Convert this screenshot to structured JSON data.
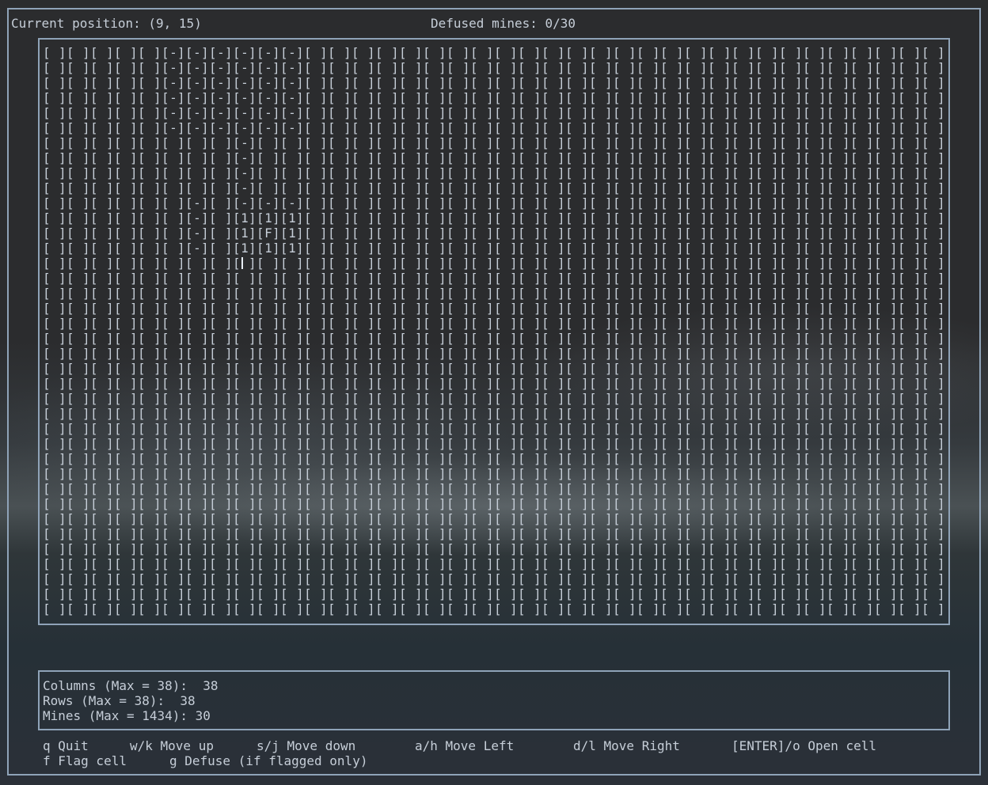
{
  "status": {
    "position_label": "Current position: (9, 15)",
    "defused_label": "Defused mines: 0/30"
  },
  "board": {
    "columns": 38,
    "rows": 38,
    "cursor": {
      "col": 8,
      "row": 14
    },
    "cell_symbols": {
      "closed": " ",
      "empty": "-",
      "flag": "F",
      "one": "1"
    },
    "revealed_rows": [
      [
        "",
        "",
        "",
        "",
        "",
        "-",
        "-",
        "-",
        "-",
        "-",
        "-"
      ],
      [
        "",
        "",
        "",
        "",
        "",
        "-",
        "-",
        "-",
        "-",
        "-",
        "-"
      ],
      [
        "",
        "",
        "",
        "",
        "",
        "-",
        "-",
        "-",
        "-",
        "-",
        "-"
      ],
      [
        "",
        "",
        "",
        "",
        "",
        "-",
        "-",
        "-",
        "-",
        "-",
        "-"
      ],
      [
        "",
        "",
        "",
        "",
        "",
        "-",
        "-",
        "-",
        "-",
        "-",
        "-"
      ],
      [
        "",
        "",
        "",
        "",
        "",
        "-",
        "-",
        "-",
        "-",
        "-",
        "-"
      ],
      [
        "",
        "",
        "",
        "",
        "",
        "",
        "",
        "",
        "-",
        "",
        ""
      ],
      [
        "",
        "",
        "",
        "",
        "",
        "",
        "",
        "",
        "-",
        "",
        ""
      ],
      [
        "",
        "",
        "",
        "",
        "",
        "",
        "",
        "",
        "-",
        "",
        ""
      ],
      [
        "",
        "",
        "",
        "",
        "",
        "",
        "",
        "",
        "-",
        "",
        ""
      ],
      [
        "",
        "",
        "",
        "",
        "",
        "",
        "-",
        "",
        "-",
        "-",
        "-"
      ],
      [
        "",
        "",
        "",
        "",
        "",
        "",
        "-",
        "",
        "1",
        "1",
        "1"
      ],
      [
        "",
        "",
        "",
        "",
        "",
        "",
        "-",
        "",
        "1",
        "F",
        "1"
      ],
      [
        "",
        "",
        "",
        "",
        "",
        "",
        "-",
        "",
        "1",
        "1",
        "1"
      ]
    ]
  },
  "settings": {
    "columns_label": "Columns (Max = 38):  38",
    "rows_label": "Rows (Max = 38):  38",
    "mines_label": "Mines (Max = 1434): 30"
  },
  "help": {
    "quit": "q Quit",
    "move_up": "w/k Move up",
    "move_down": "s/j Move down",
    "move_left": "a/h Move Left",
    "move_right": "d/l Move Right",
    "open": "[ENTER]/o Open cell",
    "flag": "f Flag cell",
    "defuse": "g Defuse (if flagged only)"
  }
}
